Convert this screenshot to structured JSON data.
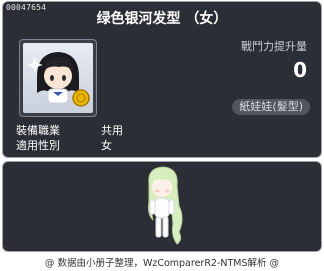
{
  "item": {
    "id": "00047654",
    "title": "绿色银河发型 （女）",
    "attack_label": "戰鬥力提升量",
    "attack_value": "0",
    "category": "紙娃娃(髮型)",
    "job_label": "裝備職業",
    "job_value": "共用",
    "gender_label": "適用性別",
    "gender_value": "女"
  },
  "footer": {
    "credit": "@ 数据由小册子整理，WzComparerR2-NTMS解析 @"
  },
  "colors": {
    "panel_bg": "#2b2e35",
    "panel_border": "#9da3ab",
    "hair": "#cfe8a8",
    "coin": "#e8b800"
  }
}
